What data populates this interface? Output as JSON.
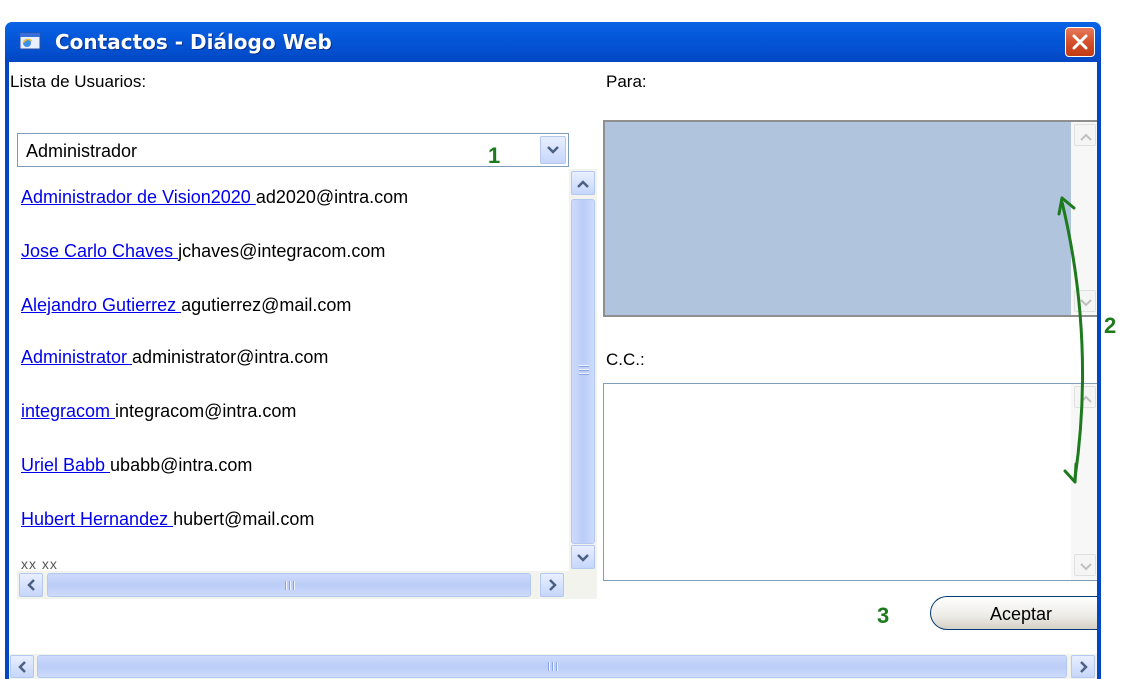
{
  "window": {
    "title": "Contactos - Diálogo Web"
  },
  "left_panel": {
    "label": "Lista de Usuarios:",
    "select_value": "Administrador",
    "users": [
      {
        "name": "Administrador de Vision2020 ",
        "email": "ad2020@intra.com"
      },
      {
        "name": "Jose Carlo Chaves ",
        "email": "jchaves@integracom.com"
      },
      {
        "name": "Alejandro Gutierrez ",
        "email": "agutierrez@mail.com"
      },
      {
        "name": "Administrator ",
        "email": "administrator@intra.com"
      },
      {
        "name": "integracom ",
        "email": "integracom@intra.com"
      },
      {
        "name": "Uriel Babb ",
        "email": "ubabb@intra.com"
      },
      {
        "name": "Hubert Hernandez ",
        "email": "hubert@mail.com"
      }
    ],
    "truncated_item": "xx xx"
  },
  "right_panel": {
    "para_label": "Para:",
    "cc_label": "C.C.:",
    "para_value": "",
    "cc_value": "",
    "accept_label": "Aceptar"
  },
  "annotations": {
    "one": "1",
    "two": "2",
    "three": "3"
  },
  "colors": {
    "titlebar": "#0457d8",
    "annotation_green": "#1d7a1d",
    "para_bg": "#b0c4de",
    "link": "#0000ee"
  },
  "icons": {
    "title": "ie-window-icon",
    "close": "close-x-icon"
  }
}
